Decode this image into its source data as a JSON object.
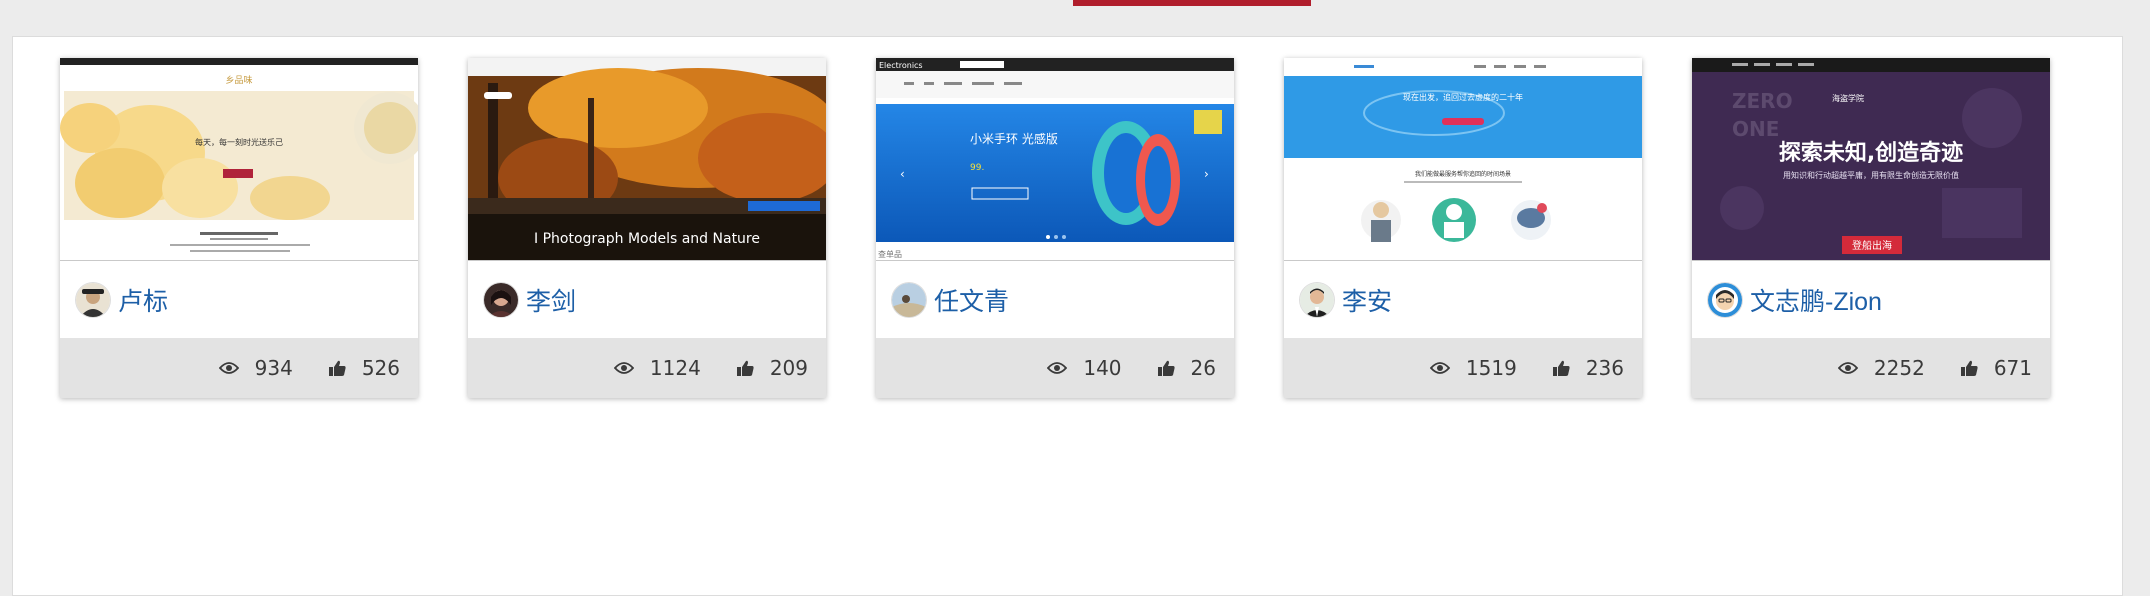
{
  "cards": [
    {
      "author": "卢标",
      "views": "934",
      "likes": "526",
      "thumb": {
        "brand": "乡品味",
        "headline": "每天，每一刻时光送乐己"
      }
    },
    {
      "author": "李剑",
      "views": "1124",
      "likes": "209",
      "thumb": {
        "headline": "I Photograph Models and Nature"
      }
    },
    {
      "author": "任文青",
      "views": "140",
      "likes": "26",
      "thumb": {
        "brand": "Electronics",
        "headline": "小米手环 光感版",
        "price": "99.",
        "caption": "查单品"
      }
    },
    {
      "author": "李安",
      "views": "1519",
      "likes": "236",
      "thumb": {
        "headline": "现在出发，追回过去虚度的二十年",
        "subhead": "我们能做最服务帮你追回的时间场景"
      }
    },
    {
      "author": "文志鹏-Zion",
      "views": "2252",
      "likes": "671",
      "thumb": {
        "brand": "海盗学院",
        "headline": "探索未知,创造奇迹",
        "subhead": "用知识和行动超越平庸，用有限生命创造无限价值",
        "cta": "登船出海"
      }
    }
  ],
  "colors": {
    "accent": "#b01e2c",
    "author_link": "#1d5fa7",
    "stats_bg": "#e3e3e3"
  },
  "icons": {
    "views": "eye-icon",
    "likes": "thumbs-up-icon"
  }
}
